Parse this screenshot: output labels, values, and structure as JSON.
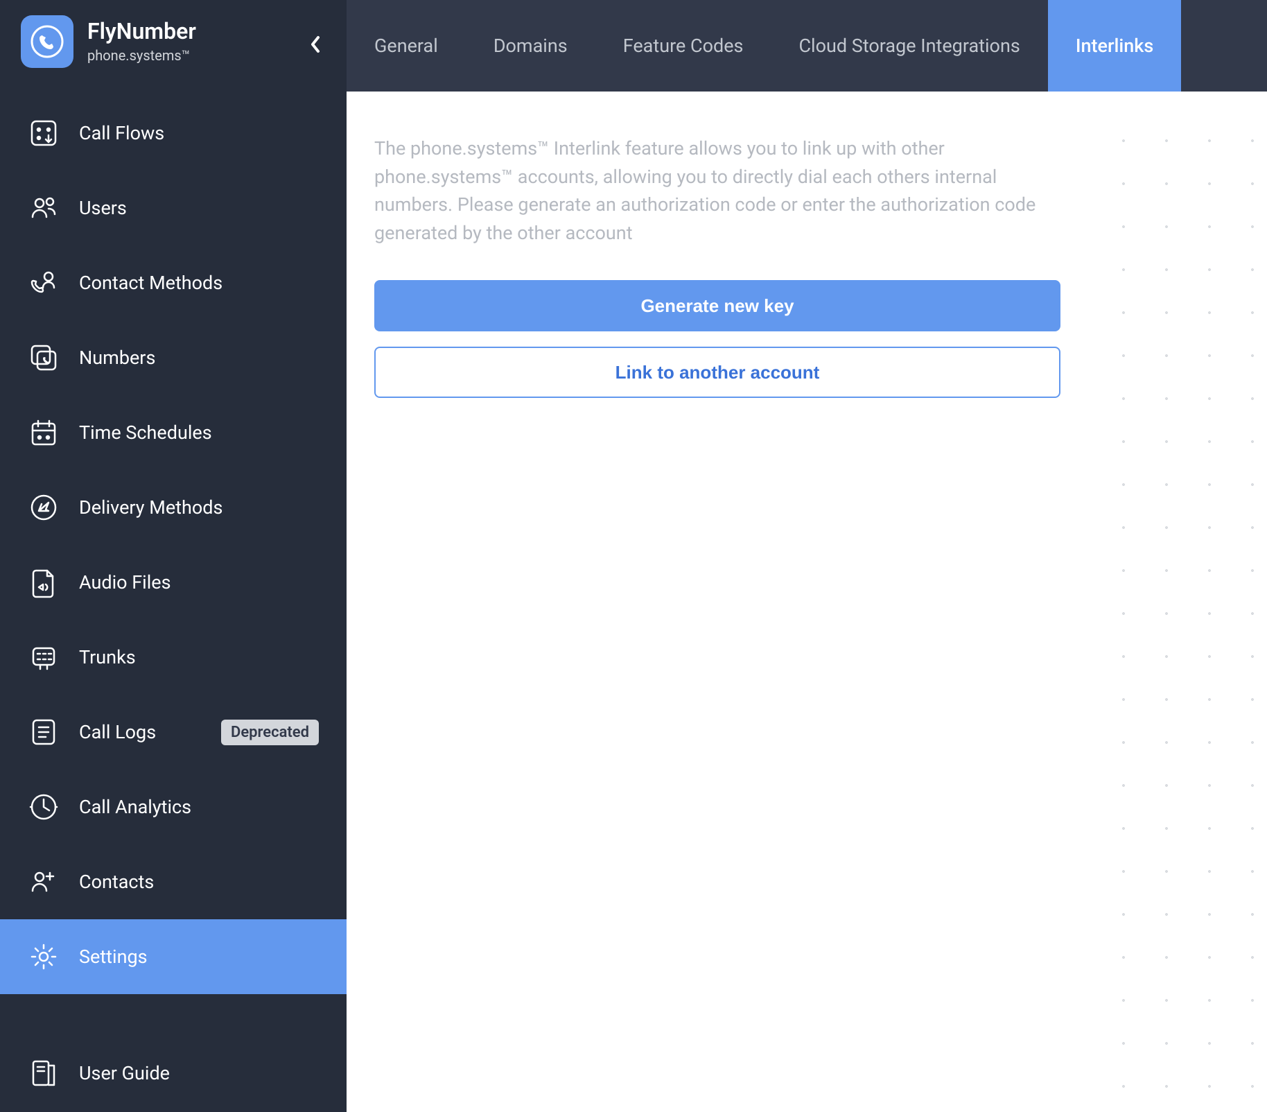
{
  "brand": {
    "title": "FlyNumber",
    "subtitle": "phone.systems™"
  },
  "sidebar": {
    "items": [
      {
        "label": "Call Flows",
        "icon": "callflows"
      },
      {
        "label": "Users",
        "icon": "users"
      },
      {
        "label": "Contact Methods",
        "icon": "contact"
      },
      {
        "label": "Numbers",
        "icon": "numbers"
      },
      {
        "label": "Time Schedules",
        "icon": "schedule"
      },
      {
        "label": "Delivery Methods",
        "icon": "delivery"
      },
      {
        "label": "Audio Files",
        "icon": "audio"
      },
      {
        "label": "Trunks",
        "icon": "trunks"
      },
      {
        "label": "Call Logs",
        "icon": "logs",
        "badge": "Deprecated"
      },
      {
        "label": "Call Analytics",
        "icon": "analytics"
      },
      {
        "label": "Contacts",
        "icon": "contacts"
      },
      {
        "label": "Settings",
        "icon": "settings",
        "active": true
      }
    ],
    "footer": {
      "label": "User Guide",
      "icon": "guide"
    }
  },
  "tabs": [
    {
      "label": "General"
    },
    {
      "label": "Domains"
    },
    {
      "label": "Feature Codes"
    },
    {
      "label": "Cloud Storage Integrations"
    },
    {
      "label": "Interlinks",
      "active": true
    }
  ],
  "content": {
    "description": "The phone.systems™ Interlink feature allows you to link up with other phone.systems™ accounts, allowing you to directly dial each others internal numbers. Please generate an authorization code or enter the authorization code generated by the other account",
    "generate_label": "Generate new key",
    "link_label": "Link to another account"
  }
}
